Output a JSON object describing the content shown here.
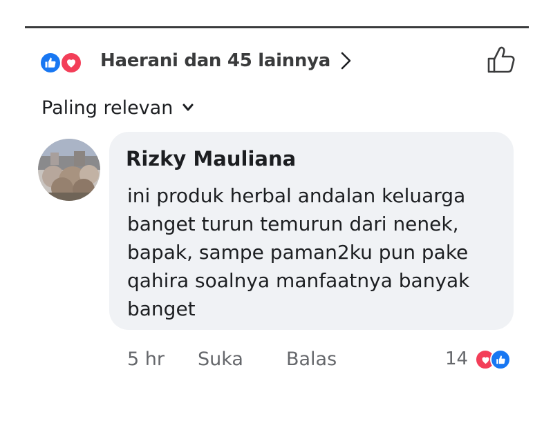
{
  "reactions": {
    "summary_text": "Haerani dan 45 lainnya",
    "icons": [
      "like-icon",
      "love-icon"
    ],
    "colors": {
      "like": "#1877f2",
      "love": "#f33e58"
    }
  },
  "sort": {
    "label": "Paling relevan"
  },
  "comment": {
    "author": "Rizky Mauliana",
    "text": "ini produk herbal andalan keluarga banget turun temurun dari nenek, bapak, sampe paman2ku pun pake qahira soalnya manfaatnya banyak banget",
    "timestamp": "5 hr",
    "like_label": "Suka",
    "reply_label": "Balas",
    "reaction_count": "14",
    "reaction_icons": [
      "love-icon",
      "like-icon"
    ]
  }
}
